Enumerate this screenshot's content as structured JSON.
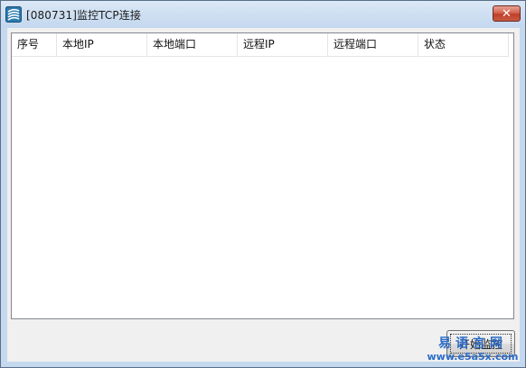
{
  "window": {
    "title": "[080731]监控TCP连接",
    "close_glyph": "✕"
  },
  "listview": {
    "columns": [
      "序号",
      "本地IP",
      "本地端口",
      "远程IP",
      "远程端口",
      "状态"
    ],
    "rows": []
  },
  "buttons": {
    "start_monitor": "开始监控"
  },
  "watermark": {
    "text": "易语言网",
    "url": "www.e5a5x.com"
  },
  "colors": {
    "accent": "#2c6cc8",
    "close_red": "#c0402a"
  }
}
